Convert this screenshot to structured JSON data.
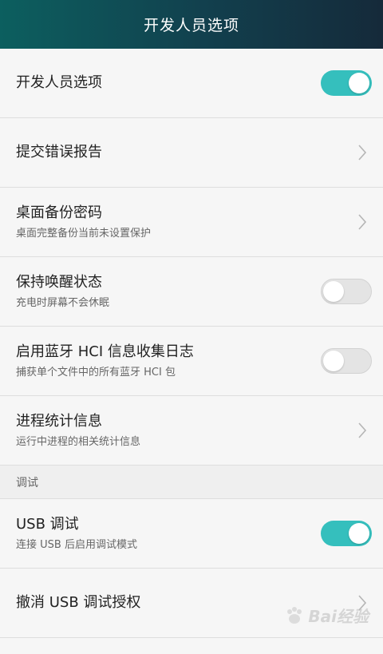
{
  "header": {
    "title": "开发人员选项"
  },
  "rows": [
    {
      "title": "开发人员选项",
      "subtitle": "",
      "control": "toggle",
      "state": "on"
    },
    {
      "title": "提交错误报告",
      "subtitle": "",
      "control": "chevron"
    },
    {
      "title": "桌面备份密码",
      "subtitle": "桌面完整备份当前未设置保护",
      "control": "chevron"
    },
    {
      "title": "保持唤醒状态",
      "subtitle": "充电时屏幕不会休眠",
      "control": "toggle",
      "state": "off"
    },
    {
      "title": "启用蓝牙 HCI 信息收集日志",
      "subtitle": "捕获单个文件中的所有蓝牙 HCI 包",
      "control": "toggle",
      "state": "off"
    },
    {
      "title": "进程统计信息",
      "subtitle": "运行中进程的相关统计信息",
      "control": "chevron"
    }
  ],
  "section": {
    "label": "调试"
  },
  "debug_rows": [
    {
      "title": "USB 调试",
      "subtitle": "连接 USB 后启用调试模式",
      "control": "toggle",
      "state": "on"
    },
    {
      "title": "撤消 USB 调试授权",
      "subtitle": "",
      "control": "chevron"
    }
  ],
  "colors": {
    "accent": "#35bfbd",
    "header_start": "#0c5f5f",
    "header_end": "#152a3a"
  }
}
